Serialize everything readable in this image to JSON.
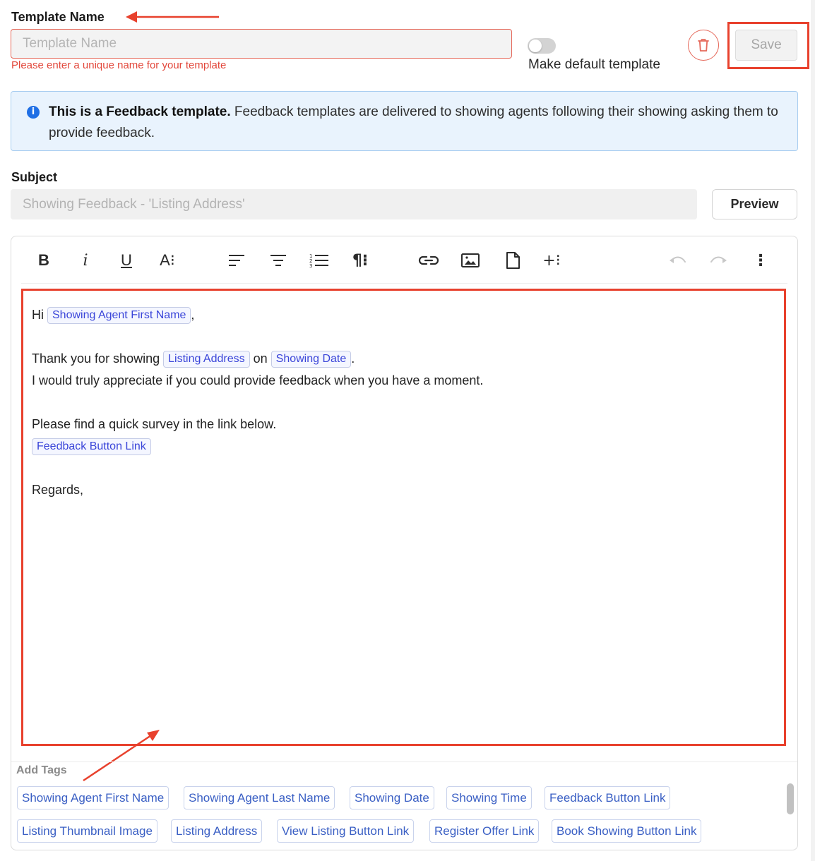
{
  "template_name": {
    "label": "Template Name",
    "placeholder": "Template Name",
    "error": "Please enter a unique name for your template"
  },
  "default_toggle": {
    "label": "Make default template",
    "on": false
  },
  "actions": {
    "save_label": "Save",
    "delete_icon": "trash-icon"
  },
  "info": {
    "bold": "This is a Feedback template.",
    "text": " Feedback templates are delivered to showing agents following their showing asking them to provide feedback."
  },
  "subject": {
    "label": "Subject",
    "placeholder": "Showing Feedback - 'Listing Address'",
    "preview_label": "Preview"
  },
  "toolbar": {
    "bold": "B",
    "italic": "i",
    "underline": "U",
    "font_size": "A⁝",
    "paragraph": "¶⁝",
    "insert": "+⁝",
    "more": "⋮"
  },
  "body": {
    "line1_pre": "Hi ",
    "line1_tag": "Showing Agent First Name",
    "line1_post": ",",
    "line2_pre": "Thank you for showing ",
    "line2_tag1": "Listing Address",
    "line2_mid": " on ",
    "line2_tag2": "Showing Date",
    "line2_post": ".",
    "line3": "I would truly appreciate if you could provide feedback when you have a moment.",
    "line4": "Please find a quick survey in the link below.",
    "line5_tag": "Feedback Button Link",
    "line6": "Regards,"
  },
  "tags": {
    "label": "Add Tags",
    "row1": [
      "Showing Agent First Name",
      "Showing Agent Last Name",
      "Showing Date",
      "Showing Time",
      "Feedback Button Link"
    ],
    "row2": [
      "Listing Thumbnail Image",
      "Listing Address",
      "View Listing Button Link",
      "Register Offer Link",
      "Book Showing Button Link"
    ]
  },
  "colors": {
    "accent_red": "#e8412d",
    "error": "#e2473b",
    "tag_text": "#3a5fc4",
    "info_bg": "#e9f3fd",
    "info_icon": "#1f6fe5"
  }
}
